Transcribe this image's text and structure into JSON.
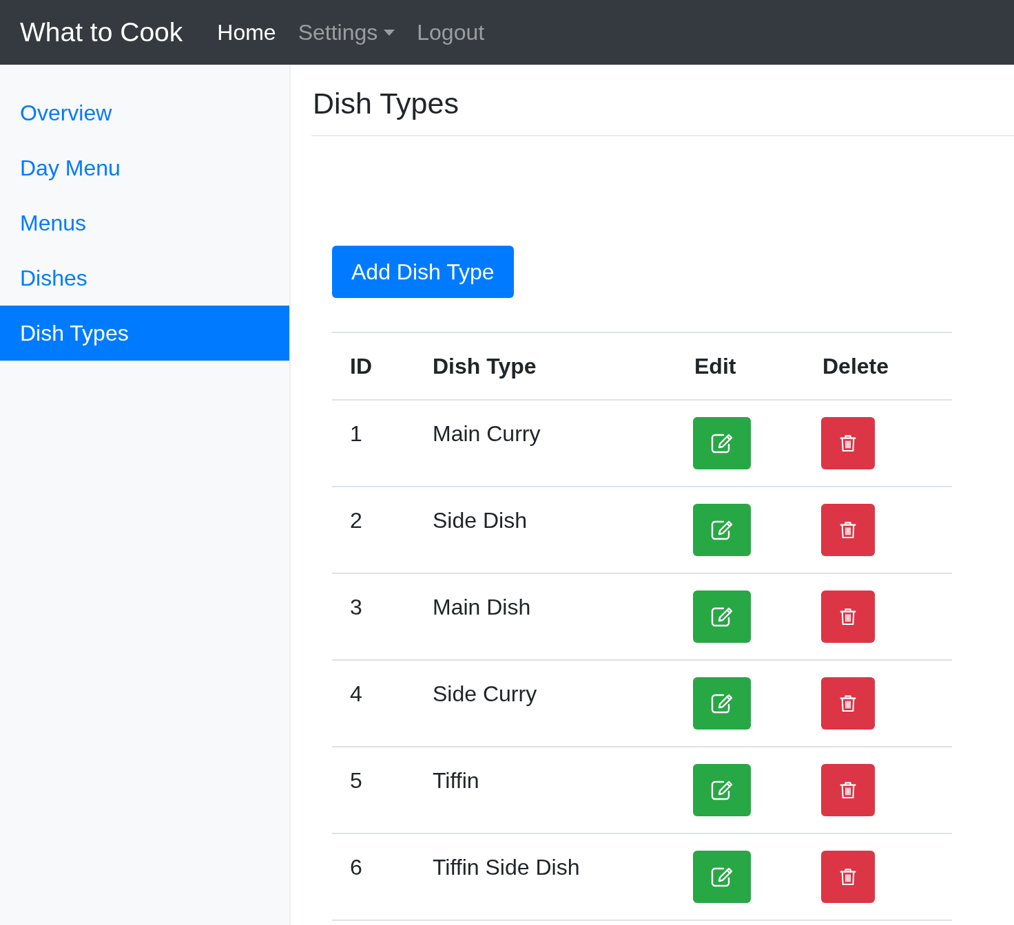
{
  "navbar": {
    "brand": "What to Cook",
    "links": [
      {
        "label": "Home",
        "selected": true,
        "kind": "link"
      },
      {
        "label": "Settings",
        "selected": false,
        "kind": "dropdown"
      },
      {
        "label": "Logout",
        "selected": false,
        "kind": "link"
      }
    ]
  },
  "sidebar": {
    "items": [
      {
        "label": "Overview",
        "selected": false
      },
      {
        "label": "Day Menu",
        "selected": false
      },
      {
        "label": "Menus",
        "selected": false
      },
      {
        "label": "Dishes",
        "selected": false
      },
      {
        "label": "Dish Types",
        "selected": true
      }
    ]
  },
  "page": {
    "title": "Dish Types",
    "add_button": "Add Dish Type"
  },
  "table": {
    "columns": [
      "ID",
      "Dish Type",
      "Edit",
      "Delete"
    ],
    "rows": [
      {
        "id": "1",
        "dish_type": "Main Curry"
      },
      {
        "id": "2",
        "dish_type": "Side Dish"
      },
      {
        "id": "3",
        "dish_type": "Main Dish"
      },
      {
        "id": "4",
        "dish_type": "Side Curry"
      },
      {
        "id": "5",
        "dish_type": "Tiffin"
      },
      {
        "id": "6",
        "dish_type": "Tiffin Side Dish"
      }
    ]
  }
}
